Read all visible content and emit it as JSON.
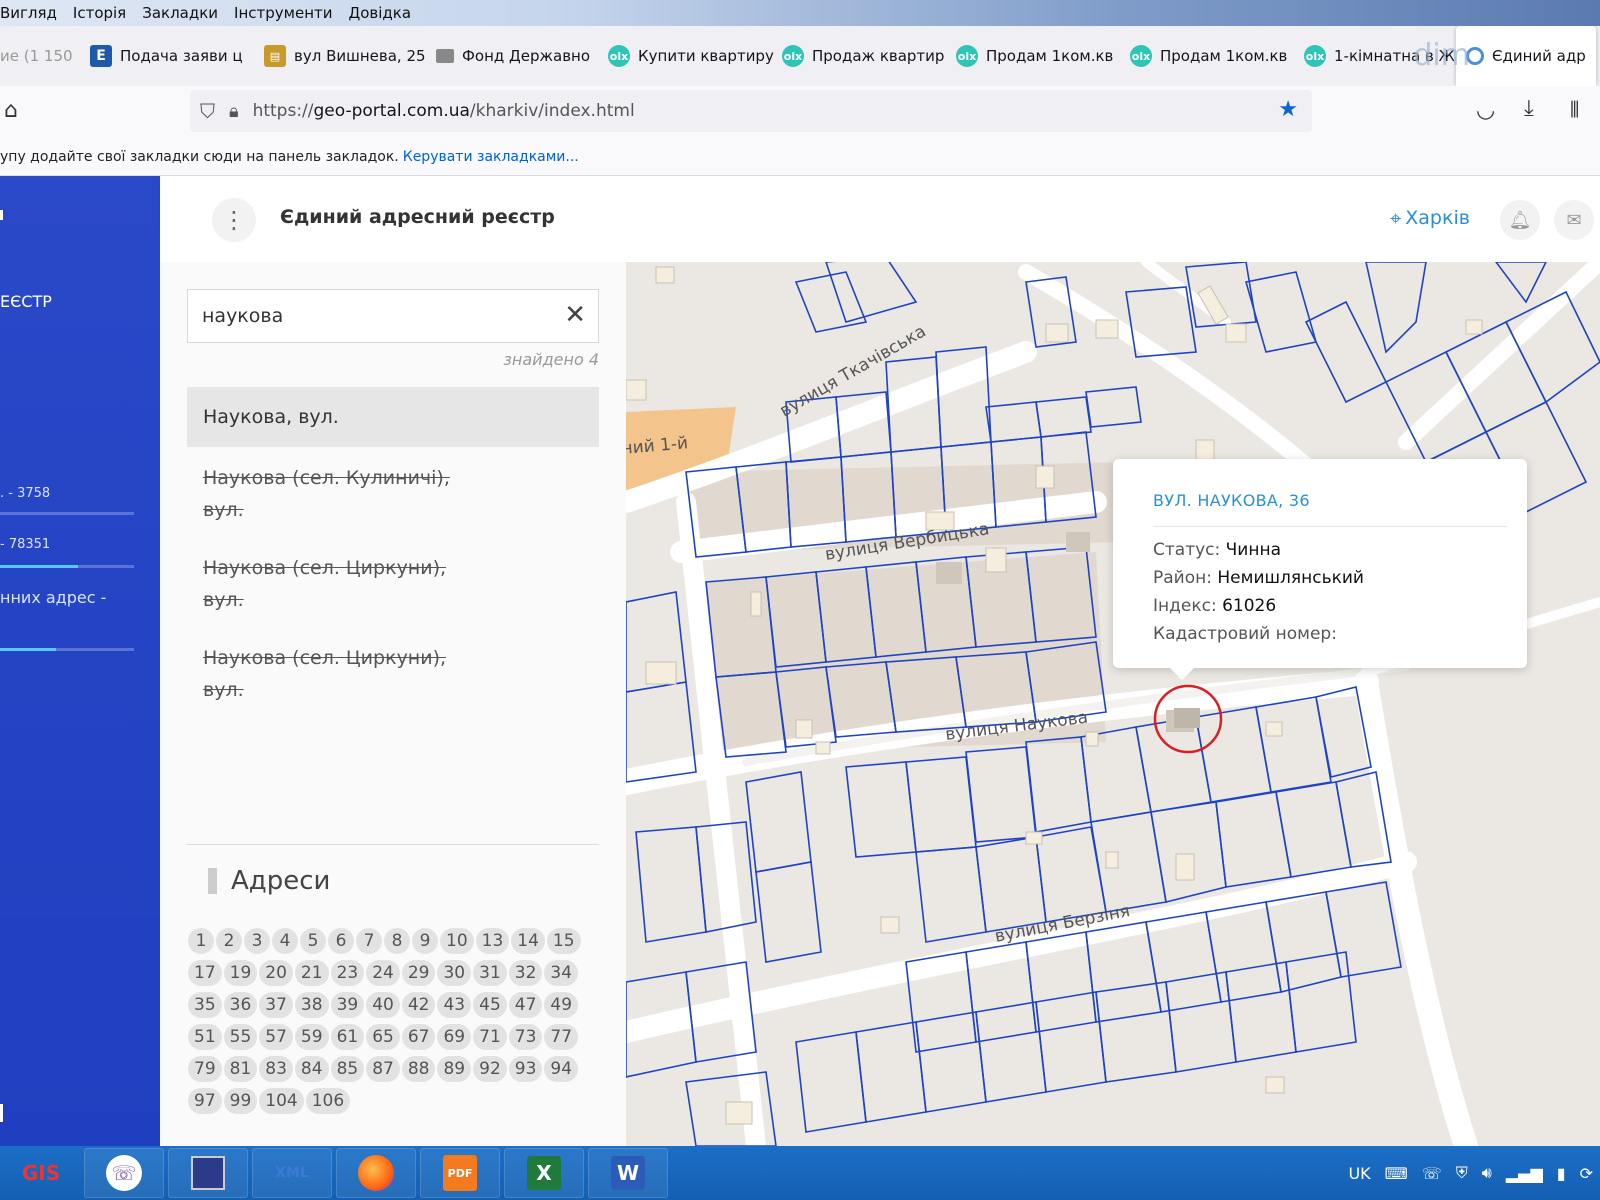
{
  "menubar": {
    "items": [
      "Вигляд",
      "Історія",
      "Закладки",
      "Інструменти",
      "Довідка"
    ]
  },
  "tabs": [
    {
      "label": "ие (1 150",
      "icon": "none"
    },
    {
      "label": "Подача заяви ц",
      "icon": "e-icon"
    },
    {
      "label": "вул Вишнева, 25",
      "icon": "cart-icon"
    },
    {
      "label": "Фонд Державно",
      "icon": "fund-icon"
    },
    {
      "label": "Купити квартиру",
      "icon": "olx-icon"
    },
    {
      "label": "Продаж квартир",
      "icon": "olx-icon"
    },
    {
      "label": "Продам 1ком.кв",
      "icon": "olx-icon"
    },
    {
      "label": "Продам 1ком.кв",
      "icon": "olx-icon"
    },
    {
      "label": "1-кімнатна в Жк",
      "icon": "olx-icon"
    },
    {
      "label": "Єдиний адр",
      "icon": "globe-icon"
    }
  ],
  "browser": {
    "url_prefix": "https://",
    "url_host": "geo-portal.com.ua",
    "url_path": "/kharkiv/index.html",
    "bookmarks_hint": "упу додайте свої закладки сюди на панель закладок.",
    "bookmarks_link": "Керувати закладками..."
  },
  "watermark": "dim",
  "leftnav": {
    "section": "ЕЄСТР",
    "stat1": ". - 3758",
    "stat2": "- 78351",
    "stat3": "нних адрес -",
    "progress": [
      0.95,
      0.6,
      0.45
    ]
  },
  "header": {
    "title": "Єдиний адресний реєстр",
    "city": "Харків"
  },
  "search": {
    "value": "наукова",
    "found_label": "знайдено 4",
    "results": [
      {
        "text": "Наукова, вул.",
        "selected": true,
        "strike": false
      },
      {
        "line1": "Наукова (сел. Кулиничі),",
        "line2": "вул.",
        "strike": true
      },
      {
        "line1": "Наукова (сел. Циркуни),",
        "line2": "вул.",
        "strike": true
      },
      {
        "line1": "Наукова (сел. Циркуни),",
        "line2": "вул.",
        "strike": true
      }
    ]
  },
  "addresses": {
    "title": "Адреси",
    "numbers": [
      "1",
      "2",
      "3",
      "4",
      "5",
      "6",
      "7",
      "8",
      "9",
      "10",
      "13",
      "14",
      "15",
      "17",
      "19",
      "20",
      "21",
      "23",
      "24",
      "29",
      "30",
      "31",
      "32",
      "34",
      "35",
      "36",
      "37",
      "38",
      "39",
      "40",
      "42",
      "43",
      "45",
      "47",
      "49",
      "51",
      "55",
      "57",
      "59",
      "61",
      "65",
      "67",
      "69",
      "71",
      "73",
      "77",
      "79",
      "81",
      "83",
      "84",
      "85",
      "87",
      "88",
      "89",
      "92",
      "93",
      "94",
      "97",
      "99",
      "104",
      "106"
    ]
  },
  "map": {
    "streets": [
      "вулиця Ткачівська",
      "вулиця Вербицька",
      "вулиця Наукова",
      "вулиця Берзіня",
      "ний 1-й"
    ],
    "parcel_color": "#1f44c2",
    "road_color": "#ffffff",
    "marker_color": "#d81f26"
  },
  "popup": {
    "title": "ВУЛ. НАУКОВА, 36",
    "status_label": "Статус:",
    "status_value": "Чинна",
    "district_label": "Район:",
    "district_value": "Немишлянський",
    "index_label": "Індекс:",
    "index_value": "61026",
    "cadastral_label": "Кадастровий номер:"
  },
  "taskbar": {
    "apps": [
      "GIS",
      "Viber",
      "Save",
      "XML",
      "Firefox",
      "PDF",
      "Excel",
      "Word"
    ],
    "lang": "UK"
  }
}
